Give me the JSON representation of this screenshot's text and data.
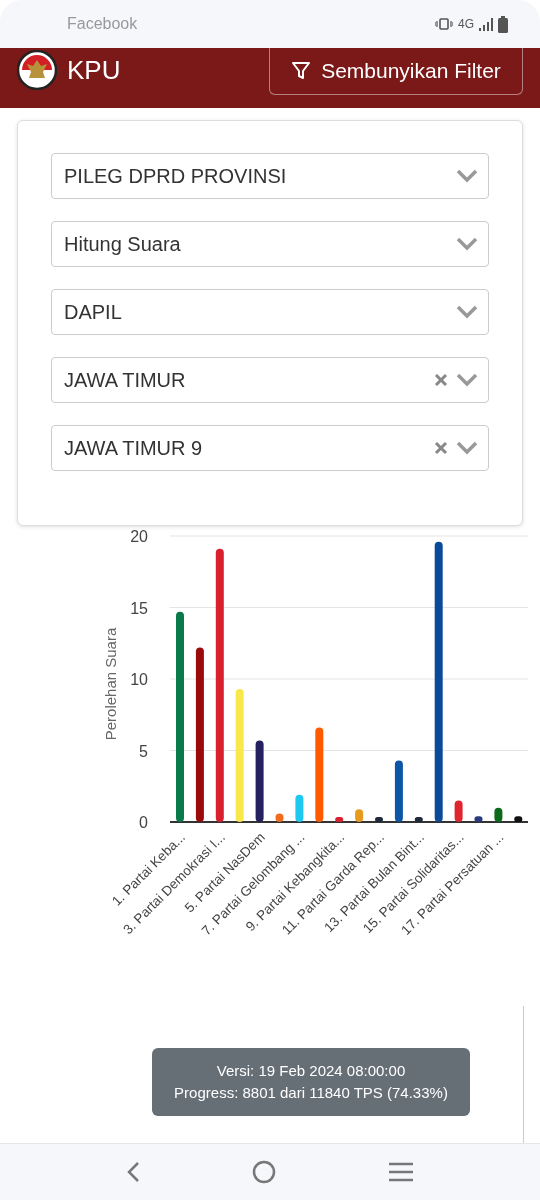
{
  "status_bar": {
    "app": "Facebook",
    "network": "4G"
  },
  "header": {
    "title": "KPU",
    "filter_button": "Sembunyikan Filter"
  },
  "filters": [
    {
      "value": "PILEG DPRD PROVINSI",
      "clearable": false
    },
    {
      "value": "Hitung Suara",
      "clearable": false
    },
    {
      "value": "DAPIL",
      "clearable": false
    },
    {
      "value": "JAWA TIMUR",
      "clearable": true
    },
    {
      "value": "JAWA TIMUR 9",
      "clearable": true
    }
  ],
  "chart": {
    "chart_data": {
      "type": "bar",
      "ylabel": "Perolehan Suara",
      "ylim": [
        0,
        20
      ],
      "yticks": [
        0,
        5,
        10,
        15,
        20
      ],
      "categories": [
        "1. Partai Keba...",
        null,
        "3. Partai Demokrasi I...",
        null,
        "5. Partai NasDem",
        null,
        "7. Partai Gelombang ...",
        null,
        "9. Partai Kebangkita...",
        null,
        "11. Partai Garda Rep...",
        null,
        "13. Partai Bulan Bint...",
        null,
        "15. Partai Solidaritas...",
        null,
        "17. Partai Persatuan ...",
        null
      ],
      "grid": true,
      "series": [
        {
          "values": [
            14.7,
            12.2,
            19.1,
            9.3,
            5.7,
            0.6,
            1.9,
            6.6,
            0.35,
            0.9,
            0.35,
            4.3,
            0.35,
            19.6,
            1.5,
            0.4,
            1.0,
            0.4
          ],
          "colors": [
            "#0a7a4a",
            "#9b0a0a",
            "#d8202e",
            "#f9e84a",
            "#25205e",
            "#f26a1b",
            "#1ec8f0",
            "#ff5a00",
            "#d8202e",
            "#e89a1e",
            "#1e2a3a",
            "#0d55a6",
            "#1e2a3a",
            "#0a4a9a",
            "#e0252e",
            "#2a3a7a",
            "#0a6a1a",
            "#111111"
          ]
        }
      ]
    }
  },
  "version_note": {
    "version": "Versi: 19 Feb 2024 08:00:00",
    "progress": "Progress: 8801 dari 11840 TPS (74.33%)"
  }
}
